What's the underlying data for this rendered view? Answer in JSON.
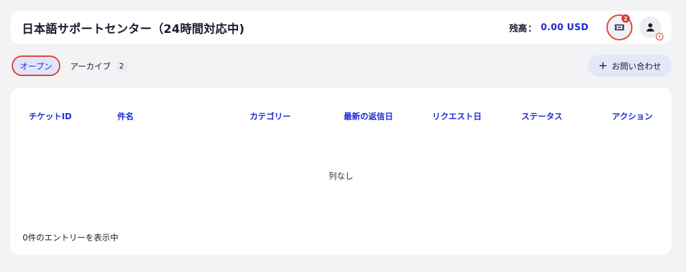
{
  "header": {
    "title": "日本語サポートセンター（24時間対応中)",
    "balance_label": "残高",
    "balance_sep": "：",
    "balance_value": "0.00 USD",
    "ticket_badge": "2",
    "user_warning": "!"
  },
  "tabs": {
    "open_label": "オープン",
    "archive_label": "アーカイブ",
    "archive_count": "2"
  },
  "contact_button": {
    "plus": "+",
    "label": "お問い合わせ"
  },
  "table": {
    "columns": [
      "チケットID",
      "件名",
      "カテゴリー",
      "最新の返信日",
      "リクエスト日",
      "ステータス",
      "アクション"
    ],
    "empty_message": "列なし",
    "footer": "0件のエントリーを表示中"
  },
  "colors": {
    "accent": "#1d2bd6",
    "highlight": "#e2442f",
    "background": "#f3f3f6"
  },
  "icons": {
    "ticket": "ticket-icon",
    "user": "user-icon"
  }
}
